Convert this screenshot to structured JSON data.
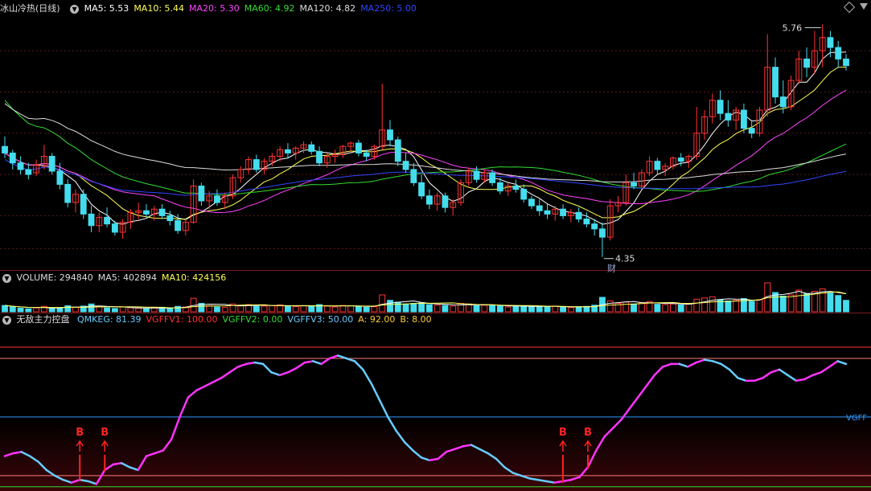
{
  "price_header": {
    "title": "冰山冷热(日线)",
    "items": [
      {
        "label": "MA5: 5.53",
        "color": "#ffffff"
      },
      {
        "label": "MA10: 5.44",
        "color": "#ffff55"
      },
      {
        "label": "MA20: 5.30",
        "color": "#ff44ff"
      },
      {
        "label": "MA60: 4.92",
        "color": "#33dd33"
      },
      {
        "label": "MA120: 4.82",
        "color": "#dddddd"
      },
      {
        "label": "MA250: 5.00",
        "color": "#3344ff"
      }
    ]
  },
  "volume_header": {
    "items": [
      {
        "label": "VOLUME: 294840",
        "color": "#dddddd"
      },
      {
        "label": "MA5: 402894",
        "color": "#dddddd"
      },
      {
        "label": "MA10: 424156",
        "color": "#ffff55"
      }
    ]
  },
  "ind_header": {
    "title": "无敌主力控盘",
    "items": [
      {
        "label": "QMKEG: 81.39",
        "color": "#66ccff"
      },
      {
        "label": "VGFFV1: 100.00",
        "color": "#ff3333"
      },
      {
        "label": "VGFFV2: 0.00",
        "color": "#33dd33"
      },
      {
        "label": "VGFFV3: 50.00",
        "color": "#66ccff"
      },
      {
        "label": "A: 92.00",
        "color": "#ffcc33"
      },
      {
        "label": "B: 8.00",
        "color": "#ffcc33"
      }
    ]
  },
  "annotations": {
    "high_label": "5.76",
    "low_label": "4.35",
    "fin_mark": "财",
    "vgff_label": "VGFF",
    "buy_mark": "B"
  },
  "chart_data": [
    {
      "type": "candlestick",
      "name": "price",
      "ylim": [
        4.3,
        5.82
      ],
      "candles": [
        [
          5.02,
          5.08,
          4.95,
          4.98
        ],
        [
          4.98,
          5.0,
          4.88,
          4.92
        ],
        [
          4.92,
          4.96,
          4.85,
          4.88
        ],
        [
          4.88,
          4.92,
          4.82,
          4.85
        ],
        [
          4.86,
          4.94,
          4.84,
          4.91
        ],
        [
          4.9,
          5.03,
          4.88,
          4.96
        ],
        [
          4.96,
          4.98,
          4.85,
          4.87
        ],
        [
          4.87,
          4.92,
          4.76,
          4.79
        ],
        [
          4.79,
          4.82,
          4.65,
          4.68
        ],
        [
          4.68,
          4.76,
          4.62,
          4.73
        ],
        [
          4.73,
          4.76,
          4.58,
          4.61
        ],
        [
          4.61,
          4.66,
          4.5,
          4.54
        ],
        [
          4.54,
          4.62,
          4.5,
          4.59
        ],
        [
          4.59,
          4.65,
          4.53,
          4.55
        ],
        [
          4.55,
          4.57,
          4.48,
          4.5
        ],
        [
          4.5,
          4.58,
          4.46,
          4.56
        ],
        [
          4.56,
          4.64,
          4.52,
          4.62
        ],
        [
          4.62,
          4.68,
          4.58,
          4.63
        ],
        [
          4.63,
          4.67,
          4.59,
          4.61
        ],
        [
          4.61,
          4.66,
          4.57,
          4.64
        ],
        [
          4.64,
          4.67,
          4.58,
          4.6
        ],
        [
          4.6,
          4.63,
          4.54,
          4.57
        ],
        [
          4.57,
          4.61,
          4.49,
          4.51
        ],
        [
          4.51,
          4.58,
          4.48,
          4.56
        ],
        [
          4.56,
          4.82,
          4.55,
          4.78
        ],
        [
          4.78,
          4.8,
          4.66,
          4.69
        ],
        [
          4.69,
          4.75,
          4.64,
          4.72
        ],
        [
          4.72,
          4.76,
          4.66,
          4.68
        ],
        [
          4.68,
          4.74,
          4.64,
          4.72
        ],
        [
          4.72,
          4.85,
          4.7,
          4.83
        ],
        [
          4.83,
          4.9,
          4.8,
          4.88
        ],
        [
          4.88,
          4.96,
          4.85,
          4.94
        ],
        [
          4.94,
          4.97,
          4.86,
          4.88
        ],
        [
          4.88,
          4.95,
          4.85,
          4.93
        ],
        [
          4.93,
          4.98,
          4.9,
          4.96
        ],
        [
          4.96,
          5.02,
          4.93,
          5.0
        ],
        [
          5.0,
          5.04,
          4.95,
          4.98
        ],
        [
          4.98,
          5.02,
          4.94,
          5.01
        ],
        [
          5.01,
          5.05,
          4.98,
          5.03
        ],
        [
          5.03,
          5.05,
          4.97,
          4.99
        ],
        [
          4.99,
          5.02,
          4.9,
          4.92
        ],
        [
          4.92,
          4.98,
          4.89,
          4.96
        ],
        [
          4.96,
          5.0,
          4.92,
          4.97
        ],
        [
          4.97,
          5.03,
          4.95,
          5.02
        ],
        [
          5.02,
          5.05,
          4.99,
          5.04
        ],
        [
          5.04,
          5.06,
          4.96,
          4.98
        ],
        [
          4.98,
          5.0,
          4.93,
          4.96
        ],
        [
          4.96,
          5.03,
          4.94,
          5.02
        ],
        [
          5.02,
          5.4,
          5.0,
          5.12
        ],
        [
          5.12,
          5.18,
          5.02,
          5.06
        ],
        [
          5.06,
          5.08,
          4.9,
          4.93
        ],
        [
          4.93,
          4.98,
          4.86,
          4.88
        ],
        [
          4.88,
          4.92,
          4.78,
          4.8
        ],
        [
          4.8,
          4.85,
          4.7,
          4.72
        ],
        [
          4.72,
          4.76,
          4.64,
          4.67
        ],
        [
          4.67,
          4.74,
          4.63,
          4.72
        ],
        [
          4.72,
          4.74,
          4.62,
          4.65
        ],
        [
          4.65,
          4.7,
          4.6,
          4.68
        ],
        [
          4.68,
          4.82,
          4.66,
          4.8
        ],
        [
          4.8,
          4.89,
          4.78,
          4.87
        ],
        [
          4.87,
          4.9,
          4.8,
          4.82
        ],
        [
          4.82,
          4.88,
          4.8,
          4.86
        ],
        [
          4.86,
          4.88,
          4.78,
          4.8
        ],
        [
          4.8,
          4.83,
          4.73,
          4.75
        ],
        [
          4.75,
          4.8,
          4.72,
          4.78
        ],
        [
          4.78,
          4.82,
          4.74,
          4.76
        ],
        [
          4.76,
          4.79,
          4.68,
          4.7
        ],
        [
          4.7,
          4.72,
          4.64,
          4.66
        ],
        [
          4.66,
          4.7,
          4.6,
          4.63
        ],
        [
          4.63,
          4.67,
          4.58,
          4.61
        ],
        [
          4.61,
          4.66,
          4.57,
          4.64
        ],
        [
          4.64,
          4.67,
          4.58,
          4.6
        ],
        [
          4.6,
          4.64,
          4.56,
          4.62
        ],
        [
          4.62,
          4.65,
          4.56,
          4.58
        ],
        [
          4.58,
          4.62,
          4.53,
          4.55
        ],
        [
          4.55,
          4.58,
          4.48,
          4.52
        ],
        [
          4.52,
          4.56,
          4.35,
          4.47
        ],
        [
          4.47,
          4.7,
          4.45,
          4.66
        ],
        [
          4.66,
          4.72,
          4.62,
          4.68
        ],
        [
          4.68,
          4.85,
          4.66,
          4.8
        ],
        [
          4.8,
          4.86,
          4.76,
          4.78
        ],
        [
          4.78,
          4.88,
          4.76,
          4.86
        ],
        [
          4.86,
          4.96,
          4.84,
          4.93
        ],
        [
          4.93,
          4.95,
          4.85,
          4.88
        ],
        [
          4.88,
          4.92,
          4.84,
          4.9
        ],
        [
          4.9,
          4.96,
          4.88,
          4.95
        ],
        [
          4.95,
          4.98,
          4.9,
          4.93
        ],
        [
          4.93,
          4.97,
          4.89,
          4.96
        ],
        [
          4.96,
          5.26,
          4.94,
          5.1
        ],
        [
          5.1,
          5.24,
          5.06,
          5.2
        ],
        [
          5.2,
          5.34,
          5.16,
          5.3
        ],
        [
          5.3,
          5.36,
          5.18,
          5.22
        ],
        [
          5.22,
          5.3,
          5.14,
          5.18
        ],
        [
          5.18,
          5.26,
          5.12,
          5.24
        ],
        [
          5.24,
          5.28,
          5.1,
          5.13
        ],
        [
          5.13,
          5.18,
          5.07,
          5.1
        ],
        [
          5.1,
          5.26,
          5.08,
          5.24
        ],
        [
          5.24,
          5.7,
          5.2,
          5.5
        ],
        [
          5.5,
          5.56,
          5.28,
          5.32
        ],
        [
          5.32,
          5.42,
          5.22,
          5.26
        ],
        [
          5.26,
          5.45,
          5.24,
          5.42
        ],
        [
          5.42,
          5.6,
          5.4,
          5.55
        ],
        [
          5.55,
          5.62,
          5.44,
          5.5
        ],
        [
          5.5,
          5.72,
          5.46,
          5.6
        ],
        [
          5.6,
          5.76,
          5.5,
          5.68
        ],
        [
          5.68,
          5.72,
          5.56,
          5.62
        ],
        [
          5.62,
          5.66,
          5.5,
          5.55
        ],
        [
          5.55,
          5.58,
          5.48,
          5.51
        ]
      ]
    },
    {
      "type": "bar",
      "name": "volume",
      "values": [
        2.1,
        1.6,
        1.2,
        1.0,
        1.3,
        1.8,
        1.1,
        1.4,
        2.0,
        1.5,
        1.9,
        2.6,
        1.7,
        1.3,
        1.1,
        1.6,
        1.4,
        1.2,
        1.0,
        1.3,
        1.5,
        1.2,
        1.8,
        1.6,
        4.5,
        2.8,
        2.0,
        1.6,
        1.5,
        2.6,
        2.2,
        2.4,
        1.8,
        1.9,
        2.1,
        2.3,
        1.9,
        1.7,
        2.0,
        1.8,
        2.4,
        1.9,
        1.6,
        2.1,
        2.0,
        1.8,
        1.5,
        1.7,
        5.6,
        3.8,
        3.2,
        2.6,
        2.8,
        3.0,
        2.4,
        2.2,
        2.1,
        1.9,
        2.8,
        2.6,
        2.0,
        2.2,
        2.1,
        1.9,
        1.6,
        1.8,
        2.0,
        1.7,
        1.8,
        1.6,
        1.9,
        1.5,
        1.4,
        1.7,
        1.8,
        2.2,
        4.8,
        3.6,
        2.8,
        3.2,
        2.6,
        3.0,
        3.4,
        2.5,
        2.4,
        2.6,
        2.3,
        2.8,
        4.2,
        4.6,
        5.0,
        4.0,
        3.6,
        3.8,
        4.4,
        3.5,
        4.0,
        9.6,
        6.4,
        5.2,
        5.6,
        7.2,
        6.0,
        6.8,
        7.6,
        6.2,
        5.4,
        3.8
      ],
      "up_color": "#ff3333",
      "down_color": "#44ddee"
    },
    {
      "type": "line",
      "name": "QMKEG",
      "ylim": [
        -3,
        115
      ],
      "ref_lines": [
        100,
        92,
        50,
        8,
        0
      ],
      "values": [
        22,
        24,
        25,
        22,
        18,
        12,
        8,
        5,
        3,
        5,
        4,
        2,
        12,
        16,
        17,
        14,
        12,
        22,
        24,
        26,
        34,
        50,
        64,
        69,
        72,
        75,
        78,
        82,
        86,
        88,
        89,
        88,
        82,
        80,
        82,
        85,
        89,
        90,
        88,
        92,
        94,
        92,
        90,
        84,
        74,
        62,
        50,
        40,
        32,
        26,
        21,
        19,
        20,
        25,
        27,
        29,
        30,
        27,
        24,
        20,
        14,
        10,
        8,
        6,
        5,
        4,
        3,
        4,
        5,
        7,
        14,
        26,
        36,
        42,
        48,
        56,
        64,
        72,
        80,
        86,
        88,
        88,
        86,
        89,
        91,
        90,
        88,
        84,
        78,
        76,
        76,
        78,
        82,
        84,
        80,
        76,
        77,
        80,
        82,
        86,
        90,
        88
      ]
    }
  ]
}
